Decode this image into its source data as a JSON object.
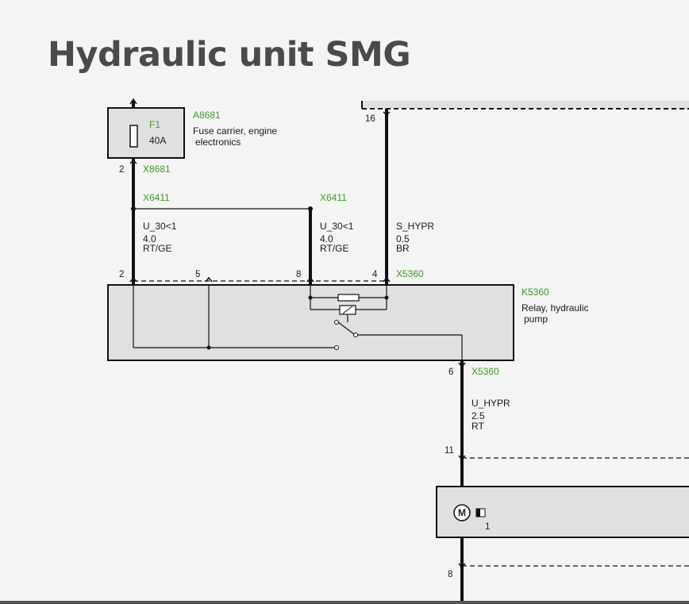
{
  "title": "Hydraulic unit SMG",
  "components": {
    "fuse_carrier": {
      "id": "A8681",
      "desc_line1": "Fuse carrier, engine",
      "desc_line2": "electronics",
      "fuse_id": "F1",
      "fuse_rating": "40A"
    },
    "relay": {
      "id": "K5360",
      "desc_line1": "Relay, hydraulic",
      "desc_line2": "pump"
    },
    "motor": {
      "symbol": "M",
      "pin": "1"
    }
  },
  "connectors": {
    "x8681": {
      "id": "X8681",
      "pin": "2"
    },
    "x6411_left": {
      "id": "X6411"
    },
    "x6411_right": {
      "id": "X6411"
    },
    "x5360_top": {
      "id": "X5360",
      "pins": [
        "2",
        "5",
        "8",
        "4"
      ]
    },
    "x5360_bottom": {
      "id": "X5360",
      "pin": "6"
    },
    "top_right_pin": "16",
    "pin_11": "11",
    "pin_8_bottom": "8"
  },
  "wires": [
    {
      "signal": "U_30<1",
      "gauge": "4.0",
      "color": "RT/GE"
    },
    {
      "signal": "U_30<1",
      "gauge": "4.0",
      "color": "RT/GE"
    },
    {
      "signal": "S_HYPR",
      "gauge": "0.5",
      "color": "BR"
    },
    {
      "signal": "U_HYPR",
      "gauge": "2.5",
      "color": "RT"
    }
  ],
  "colors": {
    "background": "#f4f4f4",
    "box_fill": "#e0e0e0",
    "label_green": "#3c9a28",
    "title": "#4a4a4a"
  }
}
